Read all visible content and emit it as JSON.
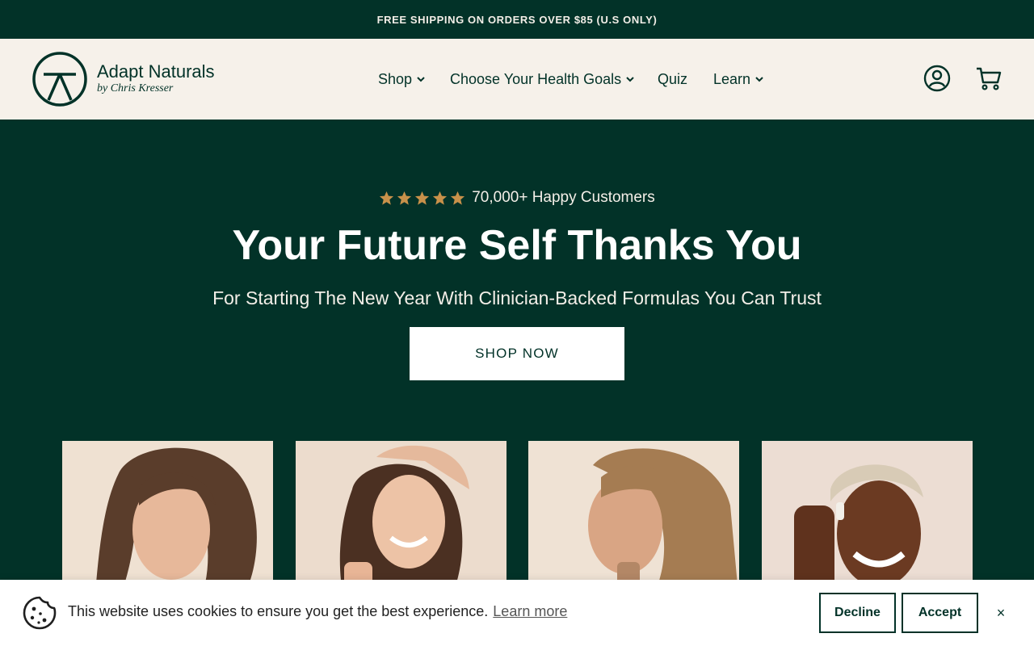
{
  "announcement": {
    "text": "FREE SHIPPING ON ORDERS OVER $85 (U.S ONLY)"
  },
  "header": {
    "logo": {
      "name": "Adapt Naturals",
      "byline": "by Chris Kresser"
    },
    "nav": [
      {
        "label": "Shop",
        "has_dropdown": true
      },
      {
        "label": "Choose Your Health Goals",
        "has_dropdown": true
      },
      {
        "label": "Quiz",
        "has_dropdown": false
      },
      {
        "label": "Learn",
        "has_dropdown": true
      }
    ],
    "icons": [
      "account-icon",
      "cart-icon"
    ]
  },
  "hero": {
    "rating": {
      "stars": 5,
      "text": "70,000+ Happy Customers"
    },
    "title": "Your Future Self Thanks You",
    "subtitle": "For Starting The New Year With Clinician-Backed Formulas You Can Trust",
    "cta_label": "SHOP NOW"
  },
  "cookie_banner": {
    "message": "This website uses cookies to ensure you get the best experience.",
    "link_label": "Learn more",
    "decline_label": "Decline",
    "accept_label": "Accept",
    "close_label": "×"
  },
  "colors": {
    "brand_green": "#023228",
    "header_bg": "#f6f1ea",
    "star_gold": "#c8914a",
    "white": "#ffffff"
  }
}
